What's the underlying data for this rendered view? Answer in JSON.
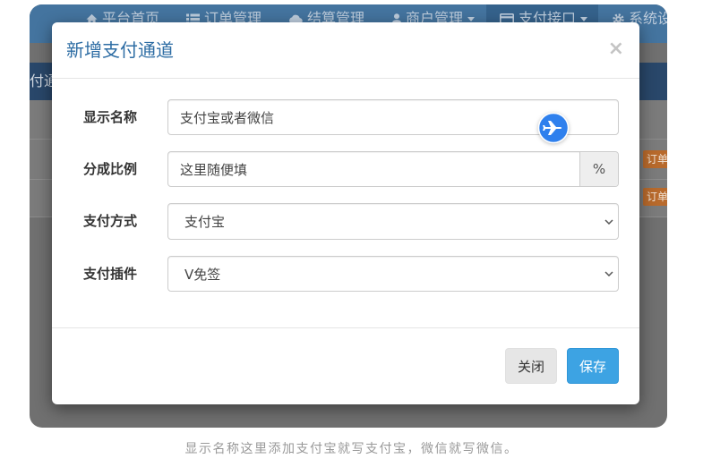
{
  "background_page": {
    "nav": {
      "items": [
        {
          "icon": "home-icon",
          "label": "平台首页"
        },
        {
          "icon": "list-icon",
          "label": "订单管理"
        },
        {
          "icon": "cloud-icon",
          "label": "结算管理"
        },
        {
          "icon": "user-icon",
          "label": "商户管理",
          "caret": true
        },
        {
          "icon": "credit-card-icon",
          "label": "支付接口",
          "caret": true,
          "active": true
        },
        {
          "icon": "gear-icon",
          "label": "系统设"
        }
      ]
    },
    "panel_title": "付通",
    "row_buttons": [
      "订单",
      "订单"
    ]
  },
  "modal": {
    "title": "新增支付通道",
    "close_symbol": "×",
    "fields": {
      "display_name": {
        "label": "显示名称",
        "value": "支付宝或者微信"
      },
      "ratio": {
        "label": "分成比例",
        "value": "这里随便填",
        "addon": "%"
      },
      "pay_method": {
        "label": "支付方式",
        "value": "支付宝"
      },
      "pay_plugin": {
        "label": "支付插件",
        "value": "V免签"
      }
    },
    "buttons": {
      "close": "关闭",
      "save": "保存"
    },
    "overlay_badge_icon": "airplane-icon"
  },
  "caption": "显示名称这里添加支付宝就写支付宝，微信就写微信。",
  "colors": {
    "navbar_bg": "#44749f",
    "nav_active_bg": "#35628c",
    "panel_heading_bg": "#29476a",
    "row_button_bg": "#b86a2c",
    "modal_title": "#2e6da4",
    "save_button_bg": "#3da3e3",
    "close_button_bg": "#e6e6e6",
    "badge_bg": "#2f80ed",
    "caption_text": "#999999"
  }
}
